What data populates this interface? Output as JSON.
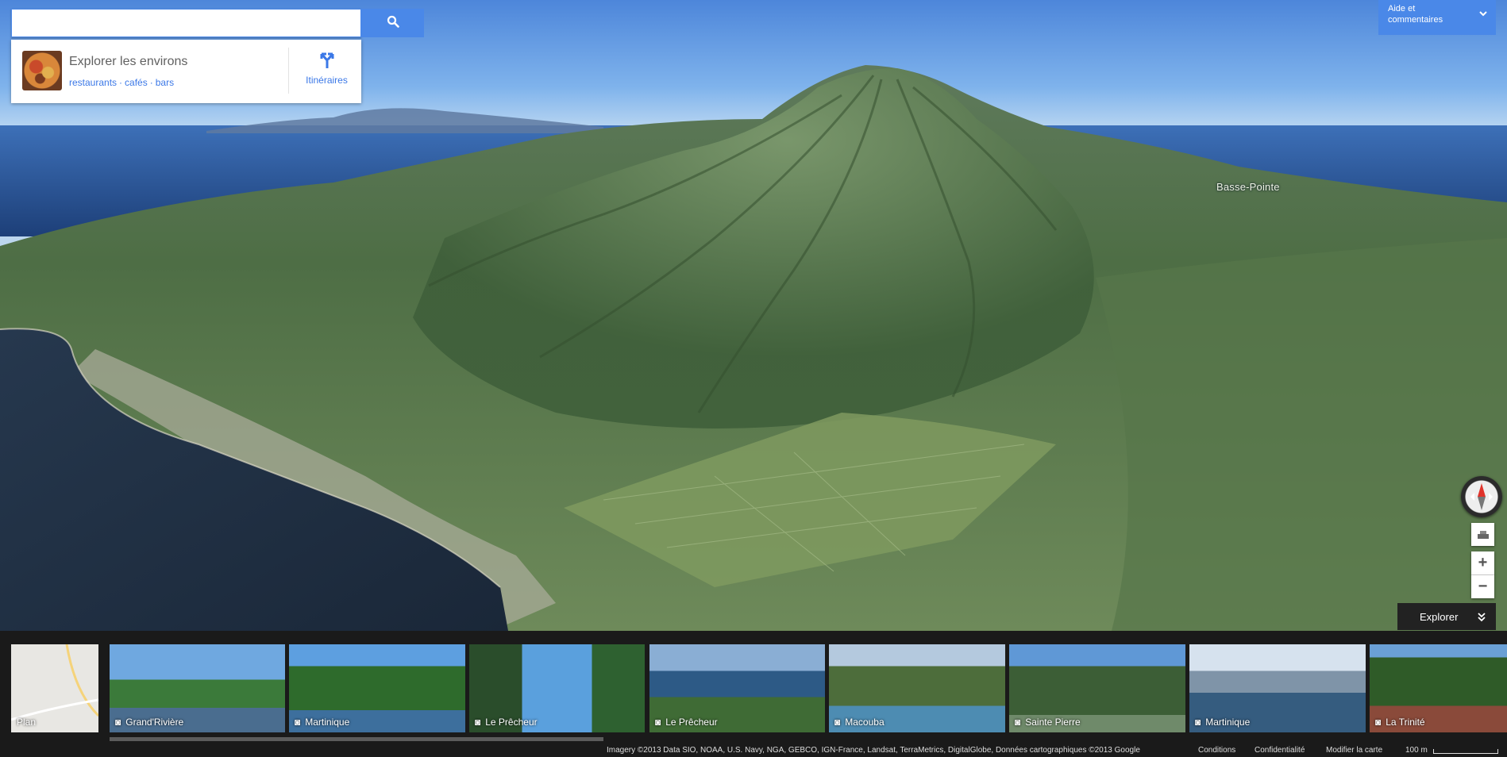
{
  "search": {
    "value": "",
    "placeholder": "",
    "button_icon": "search-icon"
  },
  "explore_card": {
    "title": "Explorer les environs",
    "links": [
      "restaurants",
      "cafés",
      "bars"
    ],
    "directions_label": "Itinéraires",
    "directions_icon": "directions-icon"
  },
  "help": {
    "line1": "Aide et",
    "line2": "commentaires",
    "icon": "chevron-down-icon"
  },
  "map": {
    "place_label": "Basse-Pointe",
    "colors": {
      "accent": "#4a88e8",
      "link": "#3b78e7"
    }
  },
  "controls": {
    "zoom_in": "+",
    "zoom_out": "−",
    "explore_label": "Explorer"
  },
  "photos": [
    {
      "label": "Plan",
      "type": "map"
    },
    {
      "label": "Grand'Rivière",
      "type": "photo"
    },
    {
      "label": "Martinique",
      "type": "photo"
    },
    {
      "label": "Le Prêcheur",
      "type": "photo"
    },
    {
      "label": "Le Prêcheur",
      "type": "photo"
    },
    {
      "label": "Macouba",
      "type": "photo"
    },
    {
      "label": "Sainte Pierre",
      "type": "photo"
    },
    {
      "label": "Martinique",
      "type": "photo"
    },
    {
      "label": "La Trinité",
      "type": "photo"
    }
  ],
  "footer": {
    "attribution": "Imagery ©2013 Data SIO, NOAA, U.S. Navy, NGA, GEBCO, IGN-France, Landsat, TerraMetrics, DigitalGlobe, Données cartographiques ©2013 Google",
    "terms": "Conditions",
    "privacy": "Confidentialité",
    "edit_map": "Modifier la carte",
    "scale": "100 m"
  }
}
